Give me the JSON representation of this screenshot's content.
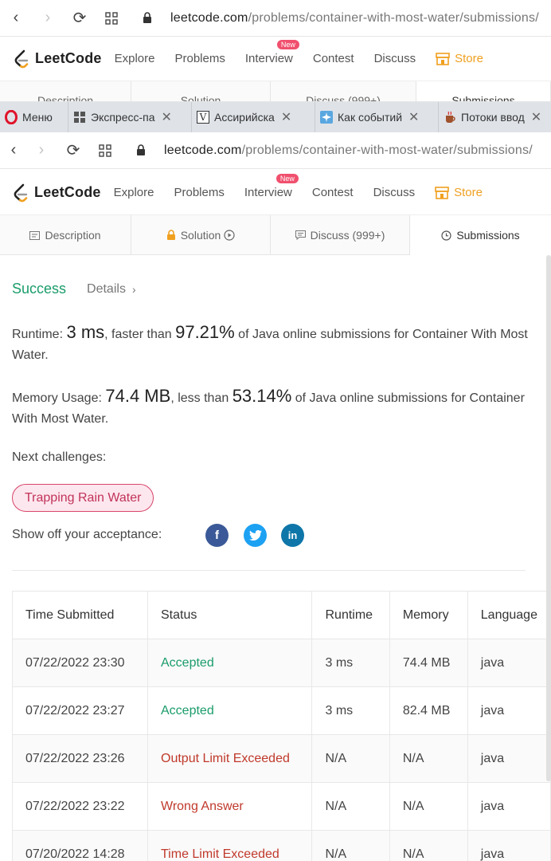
{
  "browser_back": {
    "url_domain": "leetcode.com",
    "url_path": "/problems/container-with-most-water/submissions/"
  },
  "nav_back": {
    "logo": "LeetCode",
    "links": [
      "Explore",
      "Problems",
      "Interview",
      "Contest",
      "Discuss"
    ],
    "new_badge": "New",
    "store": "Store"
  },
  "tabs_back": [
    "Description",
    "Solution",
    "Discuss (999+)",
    "Submissions"
  ],
  "opera_tabs": [
    {
      "label": "Меню"
    },
    {
      "label": "Экспресс-па"
    },
    {
      "label": "Ассирийска"
    },
    {
      "label": "Как событий"
    },
    {
      "label": "Потоки ввод"
    }
  ],
  "browser": {
    "url_domain": "leetcode.com",
    "url_path": "/problems/container-with-most-water/submissions/"
  },
  "nav": {
    "logo": "LeetCode",
    "explore": "Explore",
    "problems": "Problems",
    "interview": "Interview",
    "new_badge": "New",
    "contest": "Contest",
    "discuss": "Discuss",
    "store": "Store"
  },
  "tabs": {
    "description": "Description",
    "solution": "Solution",
    "discuss": "Discuss (999+)",
    "submissions": "Submissions"
  },
  "result": {
    "status": "Success",
    "details": "Details",
    "runtime_prefix": "Runtime: ",
    "runtime_value": "3 ms",
    "runtime_mid": ", faster than ",
    "runtime_percent": "97.21%",
    "runtime_suffix": " of Java online submissions for Container With Most Water.",
    "memory_prefix": "Memory Usage: ",
    "memory_value": "74.4 MB",
    "memory_mid": ", less than ",
    "memory_percent": "53.14%",
    "memory_suffix": " of Java online submissions for Container With Most Water.",
    "next_label": "Next challenges:",
    "next_challenge": "Trapping Rain Water",
    "share_label": "Show off your acceptance:"
  },
  "table": {
    "headers": [
      "Time Submitted",
      "Status",
      "Runtime",
      "Memory",
      "Language"
    ],
    "rows": [
      {
        "time": "07/22/2022 23:30",
        "status": "Accepted",
        "runtime": "3 ms",
        "memory": "74.4 MB",
        "lang": "java"
      },
      {
        "time": "07/22/2022 23:27",
        "status": "Accepted",
        "runtime": "3 ms",
        "memory": "82.4 MB",
        "lang": "java"
      },
      {
        "time": "07/22/2022 23:26",
        "status": "Output Limit Exceeded",
        "runtime": "N/A",
        "memory": "N/A",
        "lang": "java"
      },
      {
        "time": "07/22/2022 23:22",
        "status": "Wrong Answer",
        "runtime": "N/A",
        "memory": "N/A",
        "lang": "java"
      },
      {
        "time": "07/20/2022 14:28",
        "status": "Time Limit Exceeded",
        "runtime": "N/A",
        "memory": "N/A",
        "lang": "java"
      }
    ]
  },
  "colors": {
    "success": "#1a9c6b",
    "error": "#c0392b",
    "store": "#f0a020",
    "badge": "#f0506e",
    "facebook": "#3b5998",
    "twitter": "#1da1f2",
    "linkedin": "#0e76a8"
  }
}
